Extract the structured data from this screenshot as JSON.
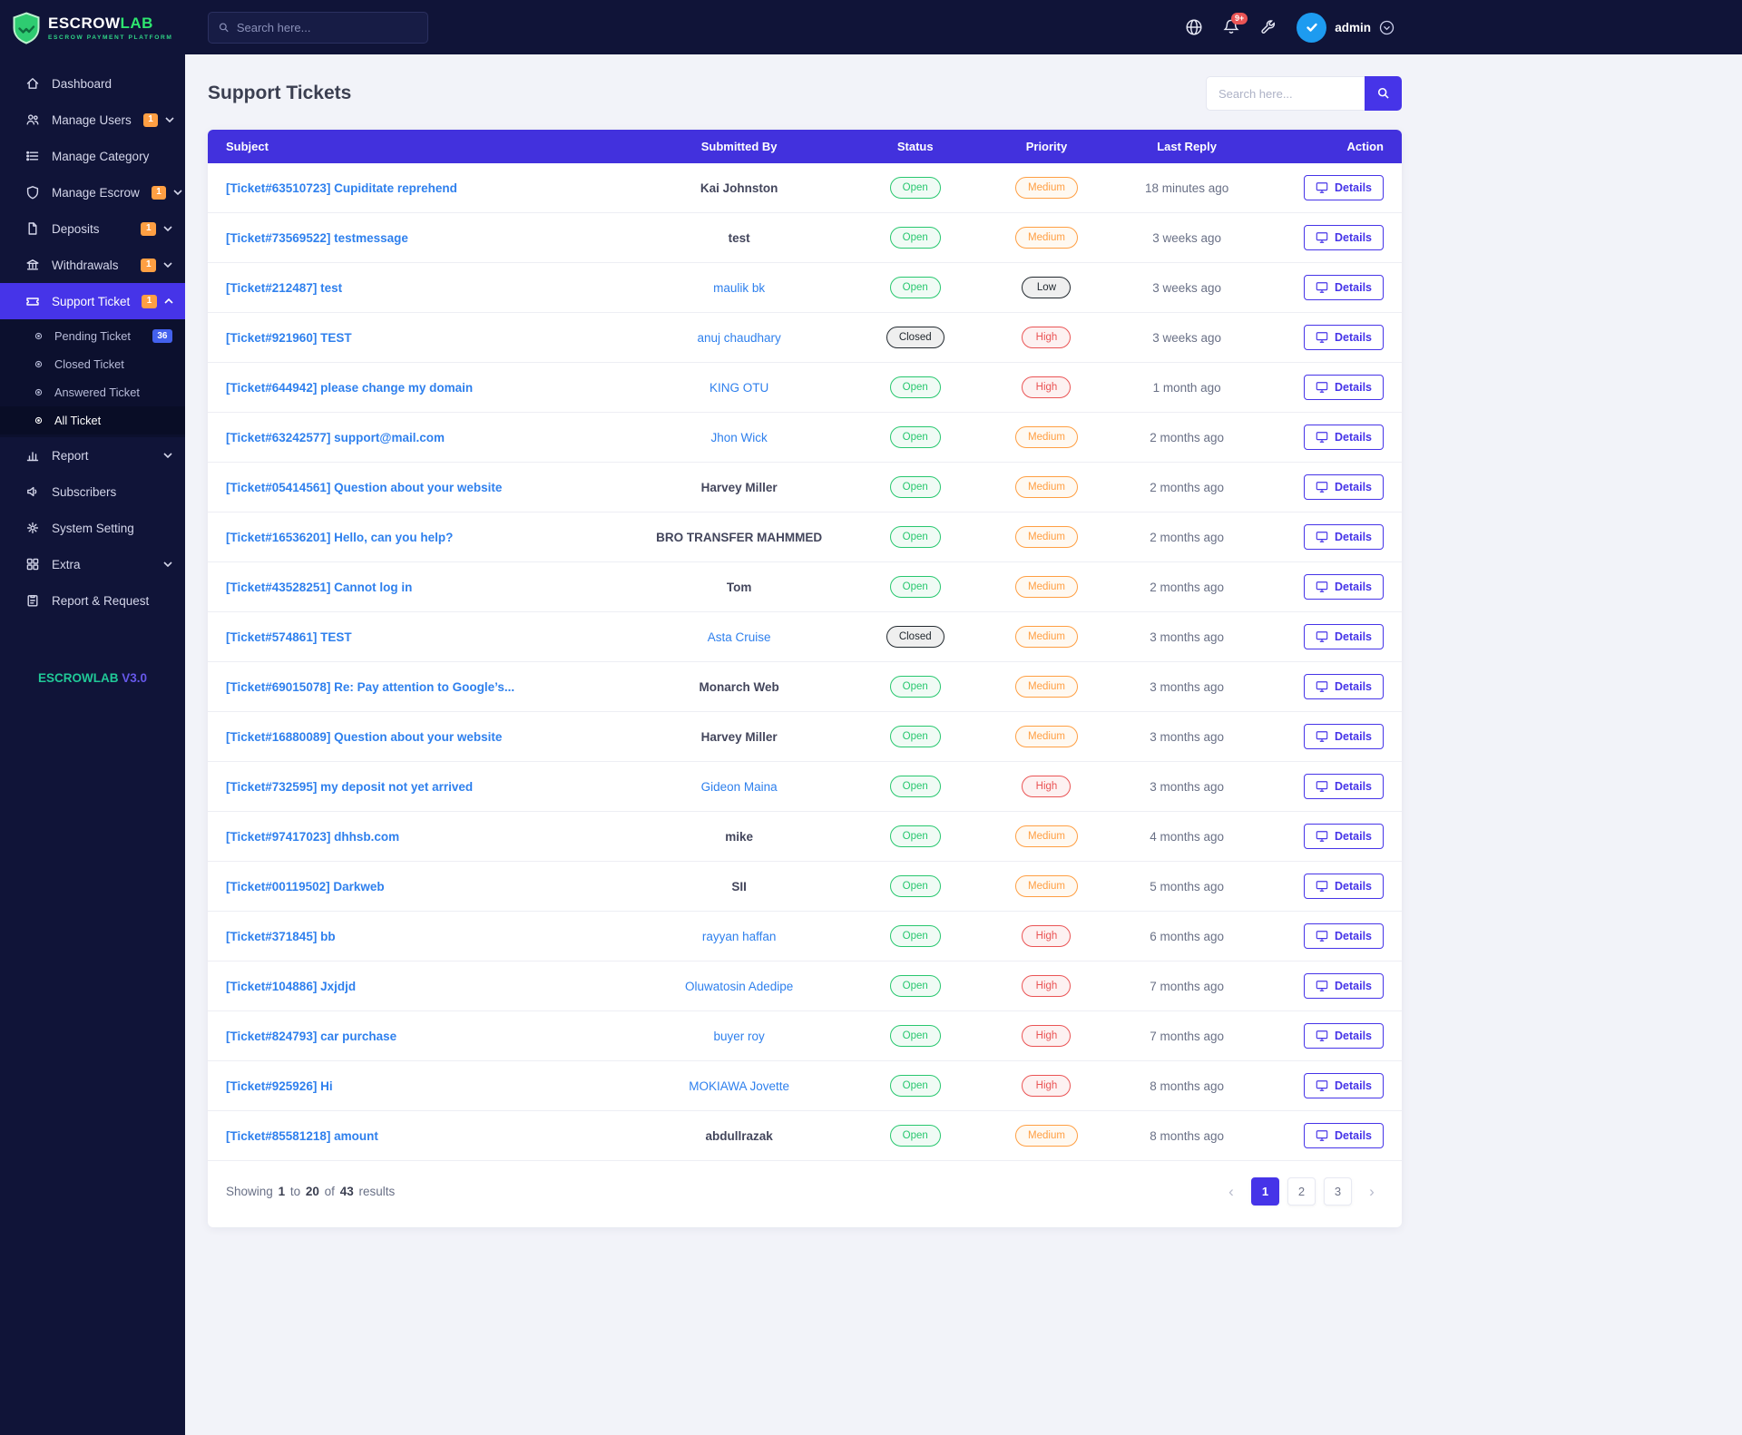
{
  "brand": {
    "name_primary": "ESCROW",
    "name_secondary": "LAB",
    "tagline": "ESCROW PAYMENT PLATFORM",
    "version_name": "ESCROWLAB",
    "version_number": "V3.0"
  },
  "topbar": {
    "search_placeholder": "Search here...",
    "notification_count": "9+",
    "user_name": "admin"
  },
  "sidebar": {
    "items": [
      {
        "label": "Dashboard",
        "icon": "home-icon"
      },
      {
        "label": "Manage Users",
        "icon": "users-icon",
        "badge": "1",
        "chevron": "down"
      },
      {
        "label": "Manage Category",
        "icon": "list-icon"
      },
      {
        "label": "Manage Escrow",
        "icon": "shield-icon",
        "badge": "1",
        "chevron": "down"
      },
      {
        "label": "Deposits",
        "icon": "document-icon",
        "badge": "1",
        "chevron": "down"
      },
      {
        "label": "Withdrawals",
        "icon": "bank-icon",
        "badge": "1",
        "chevron": "down"
      },
      {
        "label": "Support Ticket",
        "icon": "ticket-icon",
        "badge": "1",
        "chevron": "up",
        "active": true
      },
      {
        "label": "Report",
        "icon": "chart-icon",
        "chevron": "down"
      },
      {
        "label": "Subscribers",
        "icon": "megaphone-icon"
      },
      {
        "label": "System Setting",
        "icon": "gear-icon"
      },
      {
        "label": "Extra",
        "icon": "grid-icon",
        "chevron": "down"
      },
      {
        "label": "Report & Request",
        "icon": "clipboard-icon"
      }
    ],
    "submenu": [
      {
        "label": "Pending Ticket",
        "badge": "36"
      },
      {
        "label": "Closed Ticket"
      },
      {
        "label": "Answered Ticket"
      },
      {
        "label": "All Ticket",
        "active": true
      }
    ]
  },
  "page": {
    "title": "Support Tickets",
    "search_placeholder": "Search here..."
  },
  "table": {
    "headers": [
      "Subject",
      "Submitted By",
      "Status",
      "Priority",
      "Last Reply",
      "Action"
    ],
    "action_label": "Details",
    "rows": [
      {
        "subject": "[Ticket#63510723] Cupiditate reprehend",
        "submitted_by": "Kai Johnston",
        "by_link": false,
        "status": "Open",
        "priority": "Medium",
        "last_reply": "18 minutes ago"
      },
      {
        "subject": "[Ticket#73569522] testmessage",
        "submitted_by": "test",
        "by_link": false,
        "status": "Open",
        "priority": "Medium",
        "last_reply": "3 weeks ago"
      },
      {
        "subject": "[Ticket#212487] test",
        "submitted_by": "maulik bk",
        "by_link": true,
        "status": "Open",
        "priority": "Low",
        "last_reply": "3 weeks ago"
      },
      {
        "subject": "[Ticket#921960] TEST",
        "submitted_by": "anuj chaudhary",
        "by_link": true,
        "status": "Closed",
        "priority": "High",
        "last_reply": "3 weeks ago"
      },
      {
        "subject": "[Ticket#644942] please change my domain",
        "submitted_by": "KING OTU",
        "by_link": true,
        "status": "Open",
        "priority": "High",
        "last_reply": "1 month ago"
      },
      {
        "subject": "[Ticket#63242577] support@mail.com",
        "submitted_by": "Jhon Wick",
        "by_link": true,
        "status": "Open",
        "priority": "Medium",
        "last_reply": "2 months ago"
      },
      {
        "subject": "[Ticket#05414561] Question about your website",
        "submitted_by": "Harvey Miller",
        "by_link": false,
        "status": "Open",
        "priority": "Medium",
        "last_reply": "2 months ago"
      },
      {
        "subject": "[Ticket#16536201] Hello, can you help?",
        "submitted_by": "BRO TRANSFER MAHMMED",
        "by_link": false,
        "status": "Open",
        "priority": "Medium",
        "last_reply": "2 months ago"
      },
      {
        "subject": "[Ticket#43528251] Cannot log in",
        "submitted_by": "Tom",
        "by_link": false,
        "status": "Open",
        "priority": "Medium",
        "last_reply": "2 months ago"
      },
      {
        "subject": "[Ticket#574861] TEST",
        "submitted_by": "Asta Cruise",
        "by_link": true,
        "status": "Closed",
        "priority": "Medium",
        "last_reply": "3 months ago"
      },
      {
        "subject": "[Ticket#69015078] Re: Pay attention to Google’s...",
        "submitted_by": "Monarch Web",
        "by_link": false,
        "status": "Open",
        "priority": "Medium",
        "last_reply": "3 months ago"
      },
      {
        "subject": "[Ticket#16880089] Question about your website",
        "submitted_by": "Harvey Miller",
        "by_link": false,
        "status": "Open",
        "priority": "Medium",
        "last_reply": "3 months ago"
      },
      {
        "subject": "[Ticket#732595] my deposit not yet arrived",
        "submitted_by": "Gideon Maina",
        "by_link": true,
        "status": "Open",
        "priority": "High",
        "last_reply": "3 months ago"
      },
      {
        "subject": "[Ticket#97417023] dhhsb.com",
        "submitted_by": "mike",
        "by_link": false,
        "status": "Open",
        "priority": "Medium",
        "last_reply": "4 months ago"
      },
      {
        "subject": "[Ticket#00119502] Darkweb",
        "submitted_by": "SII",
        "by_link": false,
        "status": "Open",
        "priority": "Medium",
        "last_reply": "5 months ago"
      },
      {
        "subject": "[Ticket#371845] bb",
        "submitted_by": "rayyan haffan",
        "by_link": true,
        "status": "Open",
        "priority": "High",
        "last_reply": "6 months ago"
      },
      {
        "subject": "[Ticket#104886] Jxjdjd",
        "submitted_by": "Oluwatosin Adedipe",
        "by_link": true,
        "status": "Open",
        "priority": "High",
        "last_reply": "7 months ago"
      },
      {
        "subject": "[Ticket#824793] car purchase",
        "submitted_by": "buyer roy",
        "by_link": true,
        "status": "Open",
        "priority": "High",
        "last_reply": "7 months ago"
      },
      {
        "subject": "[Ticket#925926] Hi",
        "submitted_by": "MOKIAWA Jovette",
        "by_link": true,
        "status": "Open",
        "priority": "High",
        "last_reply": "8 months ago"
      },
      {
        "subject": "[Ticket#85581218] amount",
        "submitted_by": "abdullrazak",
        "by_link": false,
        "status": "Open",
        "priority": "Medium",
        "last_reply": "8 months ago"
      }
    ]
  },
  "pagination": {
    "showing_label": "Showing",
    "from": "1",
    "to_label": "to",
    "to": "20",
    "of_label": "of",
    "total": "43",
    "results_label": "results",
    "prev": "‹",
    "next": "›",
    "pages": [
      "1",
      "2",
      "3"
    ],
    "active_page": "1"
  },
  "colors": {
    "sidebar_bg": "#101438",
    "accent": "#4634e8",
    "table_header": "#4231dd",
    "status_open": "#28c76f",
    "status_closed": "#22292f",
    "priority_medium": "#ff9f43",
    "priority_high": "#ea5455",
    "badge_orange": "#ff9f43",
    "brand_green": "#2ee66f",
    "link_blue": "#2f80ed"
  }
}
